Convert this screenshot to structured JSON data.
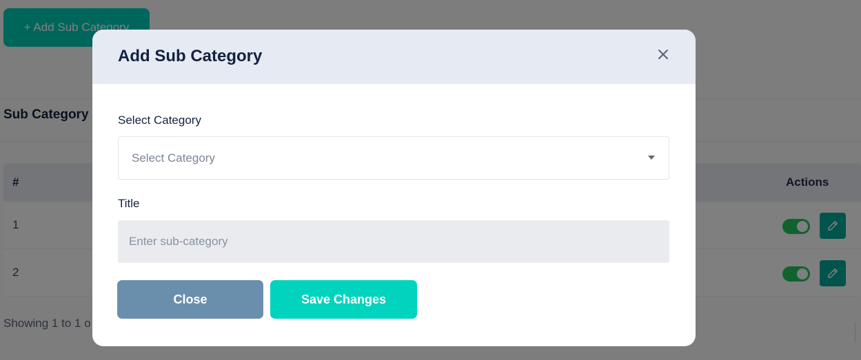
{
  "background": {
    "add_button_label": "+ Add Sub Category",
    "section_title": "Sub Category",
    "table": {
      "header_number": "#",
      "header_actions": "Actions",
      "rows": [
        {
          "number": "1",
          "active": true
        },
        {
          "number": "2",
          "active": true
        }
      ]
    },
    "footer_text": "Showing 1 to 1 o"
  },
  "modal": {
    "title": "Add Sub Category",
    "close_icon": "close-icon",
    "category_label": "Select Category",
    "category_placeholder": "Select Category",
    "title_label": "Title",
    "title_placeholder": "Enter sub-category",
    "title_value": "",
    "close_button": "Close",
    "save_button": "Save Changes"
  },
  "colors": {
    "accent": "#00cdb8",
    "save": "#00d4bf",
    "close": "#6a8fad",
    "header": "#e6eaf2",
    "toggle_on": "#22c55e",
    "edit": "#00a896"
  }
}
